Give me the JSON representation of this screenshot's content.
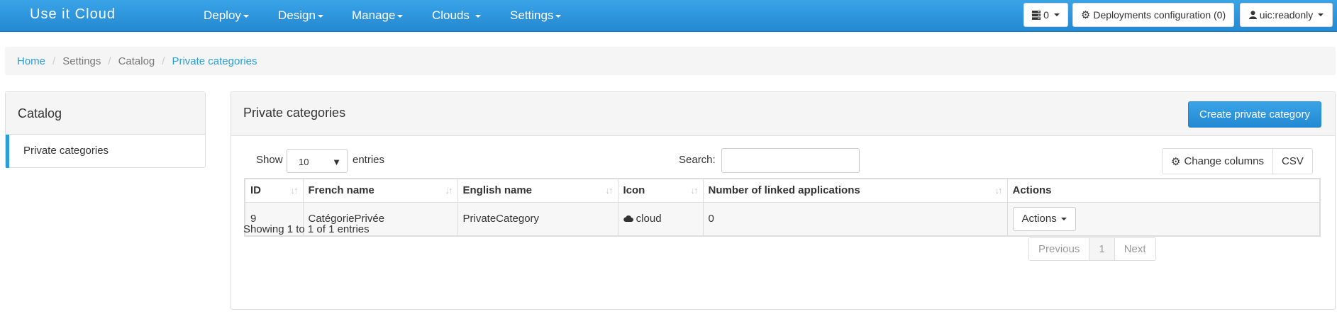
{
  "navbar": {
    "brand": "Use it Cloud",
    "menu": [
      {
        "label": "Deploy"
      },
      {
        "label": "Design"
      },
      {
        "label": "Manage"
      },
      {
        "label": "Clouds"
      },
      {
        "label": "Settings"
      }
    ],
    "queue_count": "0",
    "deployments_config_label": "Deployments configuration (0)",
    "user_label": "uic:readonly"
  },
  "breadcrumb": {
    "home": "Home",
    "settings": "Settings",
    "catalog": "Catalog",
    "current": "Private categories",
    "separator": "/"
  },
  "sidebar": {
    "title": "Catalog",
    "items": [
      {
        "label": "Private categories"
      }
    ]
  },
  "panel": {
    "title": "Private categories",
    "create_button": "Create private category",
    "show_label": "Show",
    "entries_label": "entries",
    "page_size": "10",
    "search_label": "Search:",
    "search_value": "",
    "change_columns": "Change columns",
    "csv": "CSV"
  },
  "table": {
    "columns": [
      "ID",
      "French name",
      "English name",
      "Icon",
      "Number of linked applications",
      "Actions"
    ],
    "rows": [
      {
        "id": "9",
        "french_name": "CatégoriePrivée",
        "english_name": "PrivateCategory",
        "icon": "cloud",
        "linked_apps": "0",
        "actions": "Actions"
      }
    ]
  },
  "footer": {
    "info": "Showing 1 to 1 of 1 entries",
    "previous": "Previous",
    "page": "1",
    "next": "Next"
  },
  "colors": {
    "accent": "#2a9fd6",
    "navbar": "#2a92db"
  }
}
